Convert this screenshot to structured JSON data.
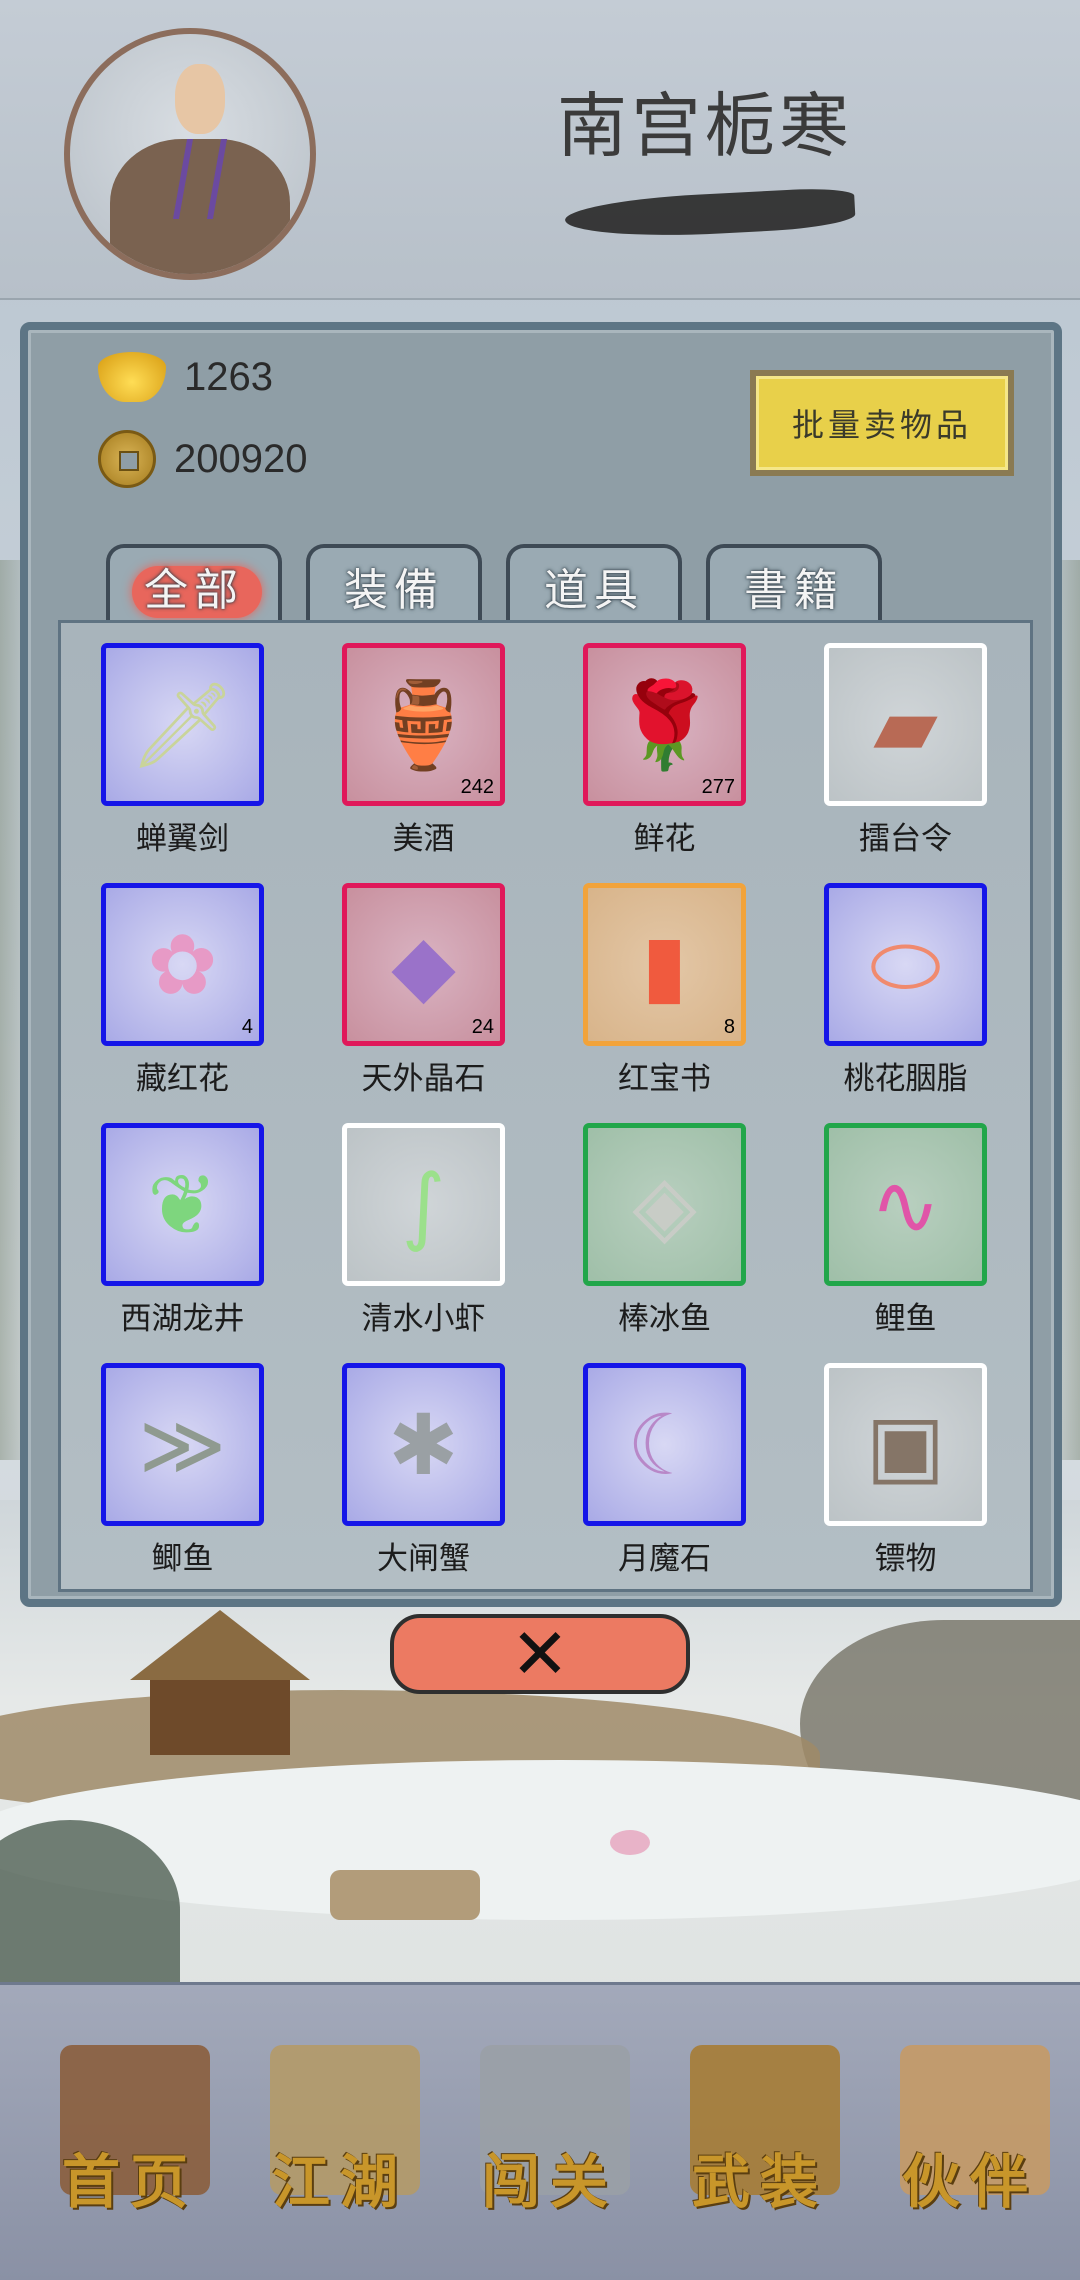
{
  "header": {
    "player_name": "南宫栀寒"
  },
  "currency": {
    "ingot_value": "1263",
    "coin_value": "200920"
  },
  "actions": {
    "sell_label": "批量卖物品",
    "close_label": "✕"
  },
  "tabs": [
    {
      "label": "全部",
      "active": true
    },
    {
      "label": "装備",
      "active": false
    },
    {
      "label": "道具",
      "active": false
    },
    {
      "label": "書籍",
      "active": false
    }
  ],
  "items": [
    {
      "name": "蝉翼剑",
      "count": "",
      "rarity": "blue",
      "icon": "sword-icon"
    },
    {
      "name": "美酒",
      "count": "242",
      "rarity": "red",
      "icon": "wine-jar-icon"
    },
    {
      "name": "鲜花",
      "count": "277",
      "rarity": "red",
      "icon": "rose-icon"
    },
    {
      "name": "擂台令",
      "count": "",
      "rarity": "white",
      "icon": "token-icon"
    },
    {
      "name": "藏红花",
      "count": "4",
      "rarity": "blue",
      "icon": "saffron-flower-icon"
    },
    {
      "name": "天外晶石",
      "count": "24",
      "rarity": "red",
      "icon": "crystal-icon"
    },
    {
      "name": "红宝书",
      "count": "8",
      "rarity": "orange",
      "icon": "red-book-icon"
    },
    {
      "name": "桃花胭脂",
      "count": "",
      "rarity": "blue",
      "icon": "rouge-box-icon"
    },
    {
      "name": "西湖龙井",
      "count": "",
      "rarity": "blue",
      "icon": "tea-leaves-icon"
    },
    {
      "name": "清水小虾",
      "count": "",
      "rarity": "white",
      "icon": "shrimp-icon"
    },
    {
      "name": "棒冰鱼",
      "count": "",
      "rarity": "green",
      "icon": "ice-fish-icon"
    },
    {
      "name": "鲤鱼",
      "count": "",
      "rarity": "green",
      "icon": "carp-icon"
    },
    {
      "name": "鲫鱼",
      "count": "",
      "rarity": "blue",
      "icon": "crucian-fish-icon"
    },
    {
      "name": "大闸蟹",
      "count": "",
      "rarity": "blue",
      "icon": "crab-icon"
    },
    {
      "name": "月魔石",
      "count": "",
      "rarity": "blue",
      "icon": "moon-stone-icon"
    },
    {
      "name": "镖物",
      "count": "",
      "rarity": "white",
      "icon": "escort-box-icon"
    }
  ],
  "nav": [
    {
      "label": "首页",
      "icon": "house-icon",
      "color": "#8a5a36"
    },
    {
      "label": "江湖",
      "icon": "scroll-icon",
      "color": "#b59a64"
    },
    {
      "label": "闯关",
      "icon": "crossed-swords-icon",
      "color": "#9aa0a6"
    },
    {
      "label": "武装",
      "icon": "armor-icon",
      "color": "#a77a2e"
    },
    {
      "label": "伙伴",
      "icon": "companions-icon",
      "color": "#c89a62"
    }
  ],
  "colors": {
    "rarity_blue": "#1515e8",
    "rarity_red": "#e0185a",
    "rarity_white": "#ffffff",
    "rarity_orange": "#f2a33a",
    "rarity_green": "#22a64a",
    "active_tab": "#e8665c",
    "sell_button": "#e8d04a",
    "close_button": "#ec7a62"
  }
}
